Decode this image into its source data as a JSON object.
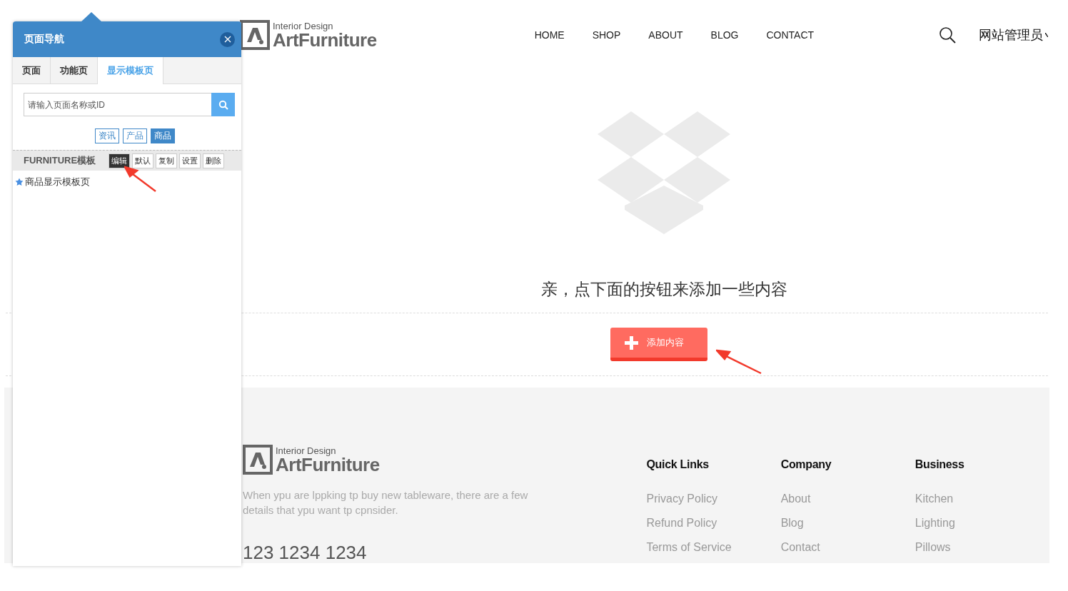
{
  "header": {
    "logo": {
      "tagline": "Interior Design",
      "name": "ArtFurniture"
    },
    "nav": [
      "HOME",
      "SHOP",
      "ABOUT",
      "BLOG",
      "CONTACT"
    ],
    "user": "网站管理员"
  },
  "empty_state": {
    "message": "亲，点下面的按钮来添加一些内容",
    "button": "添加内容"
  },
  "footer": {
    "logo": {
      "tagline": "Interior Design",
      "name": "ArtFurniture"
    },
    "description": "When ypu are lppking tp buy new tableware, there are a few details that ypu want tp cpnsider.",
    "phone": "123 1234 1234",
    "columns": [
      {
        "title": "Quick Links",
        "links": [
          "Privacy Policy",
          "Refund Policy",
          "Terms of Service"
        ]
      },
      {
        "title": "Company",
        "links": [
          "About",
          "Blog",
          "Contact"
        ]
      },
      {
        "title": "Business",
        "links": [
          "Kitchen",
          "Lighting",
          "Pillows"
        ]
      }
    ]
  },
  "panel": {
    "title": "页面导航",
    "tabs": [
      {
        "label": "页面",
        "selected": false
      },
      {
        "label": "功能页",
        "selected": false
      },
      {
        "label": "显示模板页",
        "selected": true
      }
    ],
    "search": {
      "placeholder": "请输入页面名称或ID"
    },
    "filters": [
      {
        "label": "资讯",
        "selected": false
      },
      {
        "label": "产品",
        "selected": false
      },
      {
        "label": "商品",
        "selected": true
      }
    ],
    "template": {
      "name": "FURNITURE模板",
      "actions": [
        {
          "label": "编辑",
          "selected": true
        },
        {
          "label": "默认",
          "selected": false
        },
        {
          "label": "复制",
          "selected": false
        },
        {
          "label": "设置",
          "selected": false
        },
        {
          "label": "删除",
          "selected": false
        }
      ]
    },
    "items": [
      "商品显示模板页"
    ]
  }
}
